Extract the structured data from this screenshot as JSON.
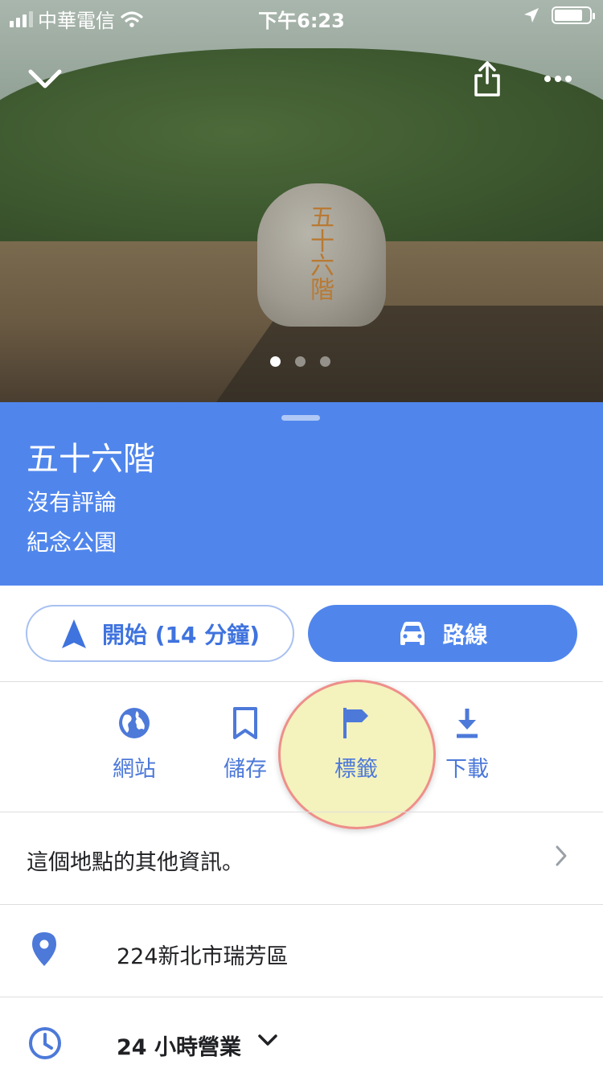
{
  "status_bar": {
    "carrier": "中華電信",
    "time": "下午6:23",
    "signal_bars": 3,
    "battery_level": 0.85,
    "icons": [
      "signal-icon",
      "wifi-icon",
      "location-arrow-icon",
      "battery-icon"
    ]
  },
  "photo": {
    "inscription": "五十六階",
    "page_count": 3,
    "current_page": 1,
    "icons": [
      "chevron-down-icon",
      "share-icon",
      "more-icon"
    ]
  },
  "place": {
    "title": "五十六階",
    "reviews": "沒有評論",
    "category": "紀念公園"
  },
  "buttons": {
    "start": "開始 (14 分鐘)",
    "route": "路線"
  },
  "actions": [
    {
      "label": "網站",
      "icon": "globe-icon"
    },
    {
      "label": "儲存",
      "icon": "bookmark-icon"
    },
    {
      "label": "標籤",
      "icon": "flag-icon"
    },
    {
      "label": "下載",
      "icon": "download-icon"
    }
  ],
  "more_info": "這個地點的其他資訊。",
  "address": "224新北市瑞芳區",
  "hours": "24 小時營業",
  "colors": {
    "brand_blue": "#5086ec",
    "action_blue": "#4d79d9",
    "highlight_fill": "#f2f0b2",
    "highlight_ring": "#ee8f8a"
  }
}
